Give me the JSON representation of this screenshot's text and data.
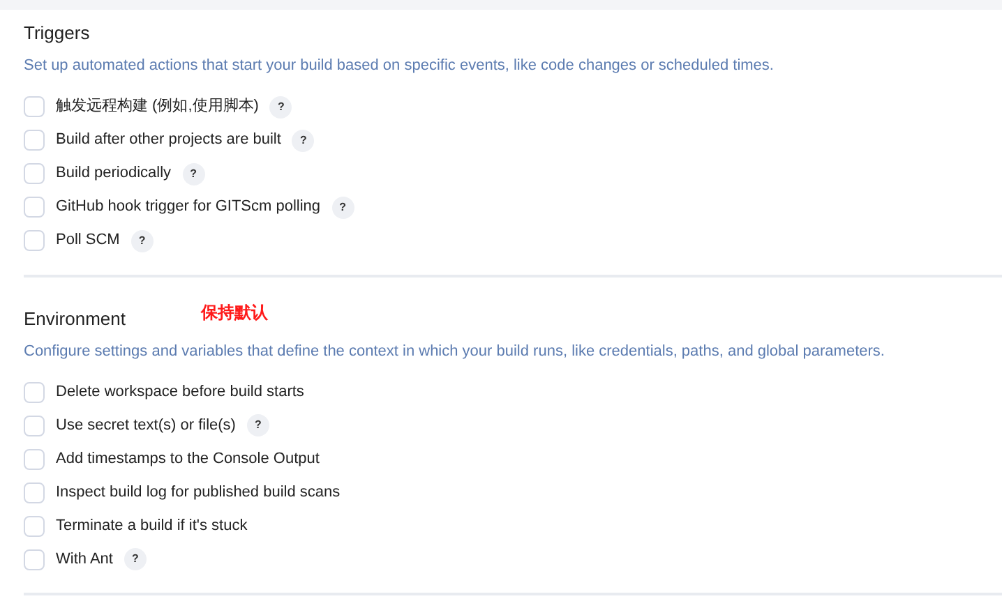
{
  "sections": [
    {
      "title": "Triggers",
      "description": "Set up automated actions that start your build based on specific events, like code changes or scheduled times.",
      "options": [
        {
          "label": "触发远程构建 (例如,使用脚本)",
          "checked": false,
          "help": "?"
        },
        {
          "label": "Build after other projects are built",
          "checked": false,
          "help": "?"
        },
        {
          "label": "Build periodically",
          "checked": false,
          "help": "?"
        },
        {
          "label": "GitHub hook trigger for GITScm polling",
          "checked": false,
          "help": "?"
        },
        {
          "label": "Poll SCM",
          "checked": false,
          "help": "?"
        }
      ]
    },
    {
      "title": "Environment",
      "annotation": "保持默认",
      "description": "Configure settings and variables that define the context in which your build runs, like credentials, paths, and global parameters.",
      "options": [
        {
          "label": "Delete workspace before build starts",
          "checked": false
        },
        {
          "label": "Use secret text(s) or file(s)",
          "checked": false,
          "help": "?"
        },
        {
          "label": "Add timestamps to the Console Output",
          "checked": false
        },
        {
          "label": "Inspect build log for published build scans",
          "checked": false
        },
        {
          "label": "Terminate a build if it's stuck",
          "checked": false
        },
        {
          "label": "With Ant",
          "checked": false,
          "help": "?"
        }
      ]
    }
  ]
}
